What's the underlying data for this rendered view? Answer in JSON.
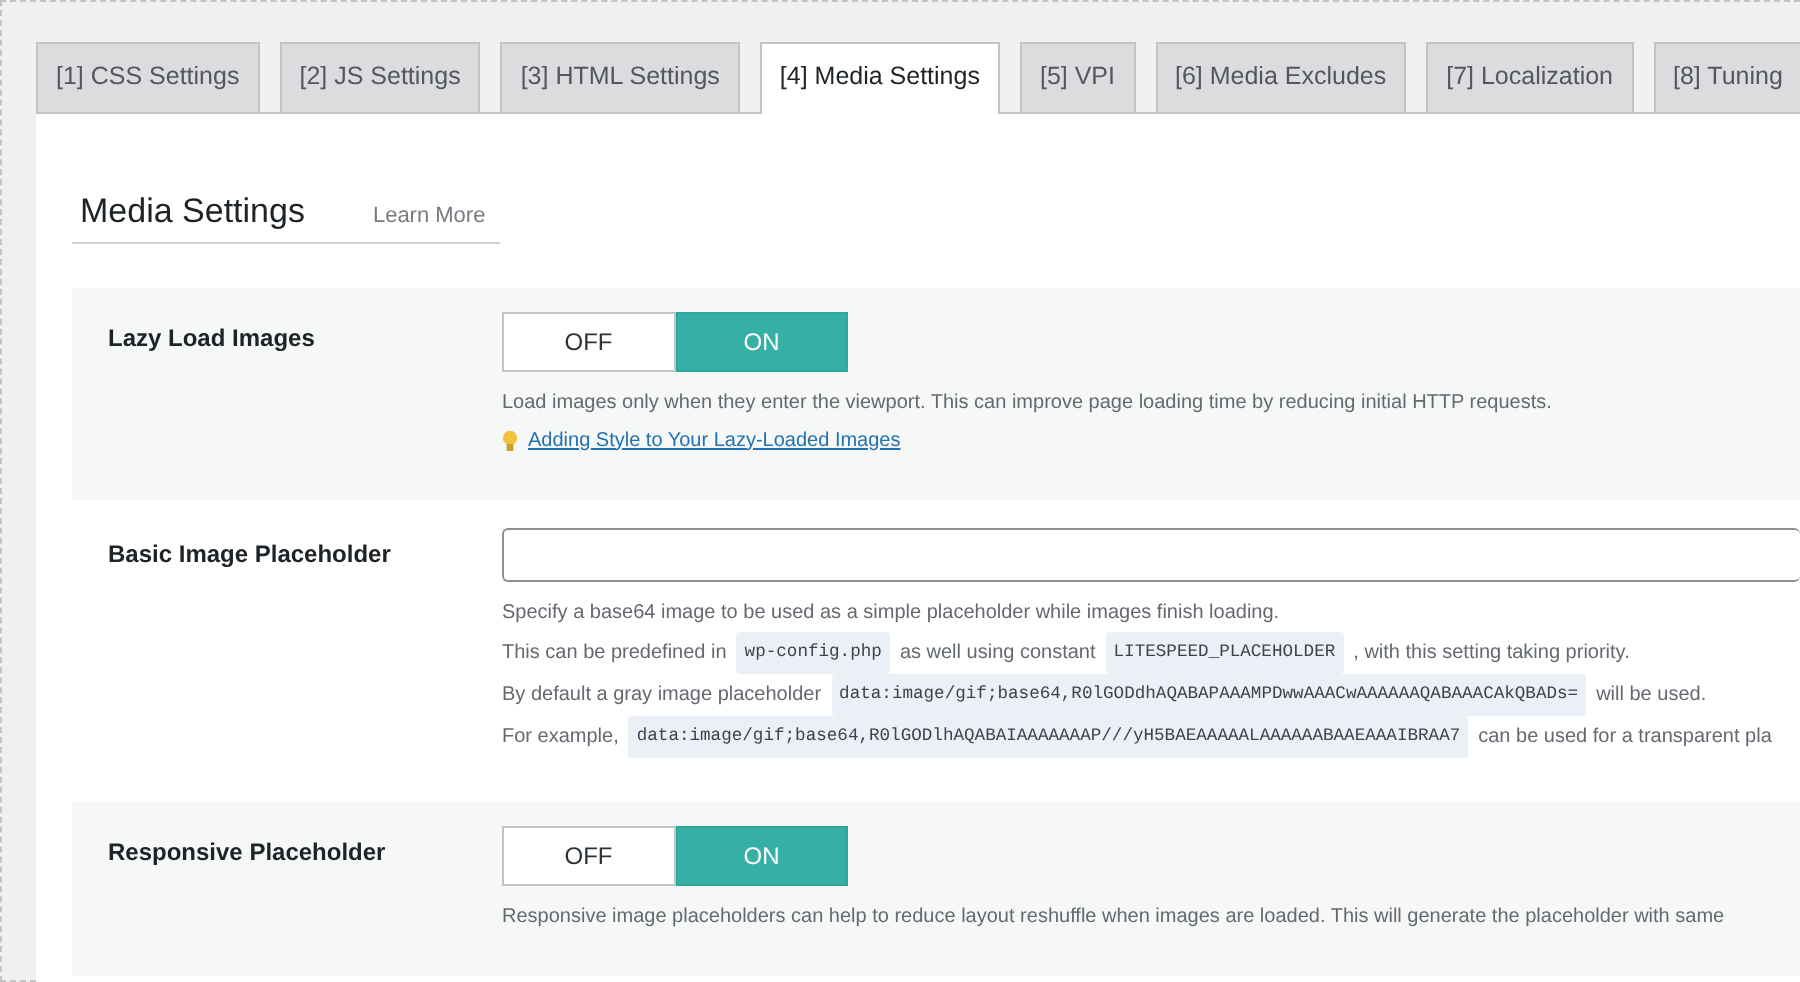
{
  "tabs": [
    {
      "label": "[1] CSS Settings",
      "selected": false
    },
    {
      "label": "[2] JS Settings",
      "selected": false
    },
    {
      "label": "[3] HTML Settings",
      "selected": false
    },
    {
      "label": "[4] Media Settings",
      "selected": true
    },
    {
      "label": "[5] VPI",
      "selected": false
    },
    {
      "label": "[6] Media Excludes",
      "selected": false
    },
    {
      "label": "[7] Localization",
      "selected": false
    },
    {
      "label": "[8] Tuning",
      "selected": false
    }
  ],
  "section": {
    "title": "Media Settings",
    "learn_more": "Learn More"
  },
  "settings": [
    {
      "kind": "toggle",
      "label": "Lazy Load Images",
      "off_label": "OFF",
      "on_label": "ON",
      "on": true,
      "description": [
        [
          {
            "kind": "text",
            "text": "Load images only when they enter the viewport. This can improve page loading time by reducing initial HTTP requests."
          }
        ]
      ],
      "link": "Adding Style to Your Lazy-Loaded Images"
    },
    {
      "kind": "text-field",
      "label": "Basic Image Placeholder",
      "description": [
        [
          {
            "kind": "text",
            "text": "Specify a base64 image to be used as a simple placeholder while images finish loading."
          }
        ],
        [
          {
            "kind": "text",
            "text": "This can be predefined in"
          },
          {
            "kind": "code",
            "text": "wp-config.php"
          },
          {
            "kind": "text",
            "text": "as well using constant"
          },
          {
            "kind": "code",
            "text": "LITESPEED_PLACEHOLDER"
          },
          {
            "kind": "text",
            "text": ", with this setting taking priority."
          }
        ],
        [
          {
            "kind": "text",
            "text": "By default a gray image placeholder"
          },
          {
            "kind": "code",
            "text": "data:image/gif;base64,R0lGODdhAQABAPAAAMPDwwAAACwAAAAAAQABAAACAkQBADs="
          },
          {
            "kind": "text",
            "text": "will be used."
          }
        ],
        [
          {
            "kind": "text",
            "text": "For example,"
          },
          {
            "kind": "code",
            "text": "data:image/gif;base64,R0lGODlhAQABAIAAAAAAAP///yH5BAEAAAAALAAAAAABAAEAAAIBRAA7"
          },
          {
            "kind": "text",
            "text": "can be used for a transparent pla"
          }
        ]
      ]
    },
    {
      "kind": "toggle",
      "label": "Responsive Placeholder",
      "off_label": "OFF",
      "on_label": "ON",
      "on": true,
      "description": [
        [
          {
            "kind": "text",
            "text": "Responsive image placeholders can help to reduce layout reshuffle when images are loaded. This will generate the placeholder with same"
          }
        ]
      ]
    }
  ]
}
